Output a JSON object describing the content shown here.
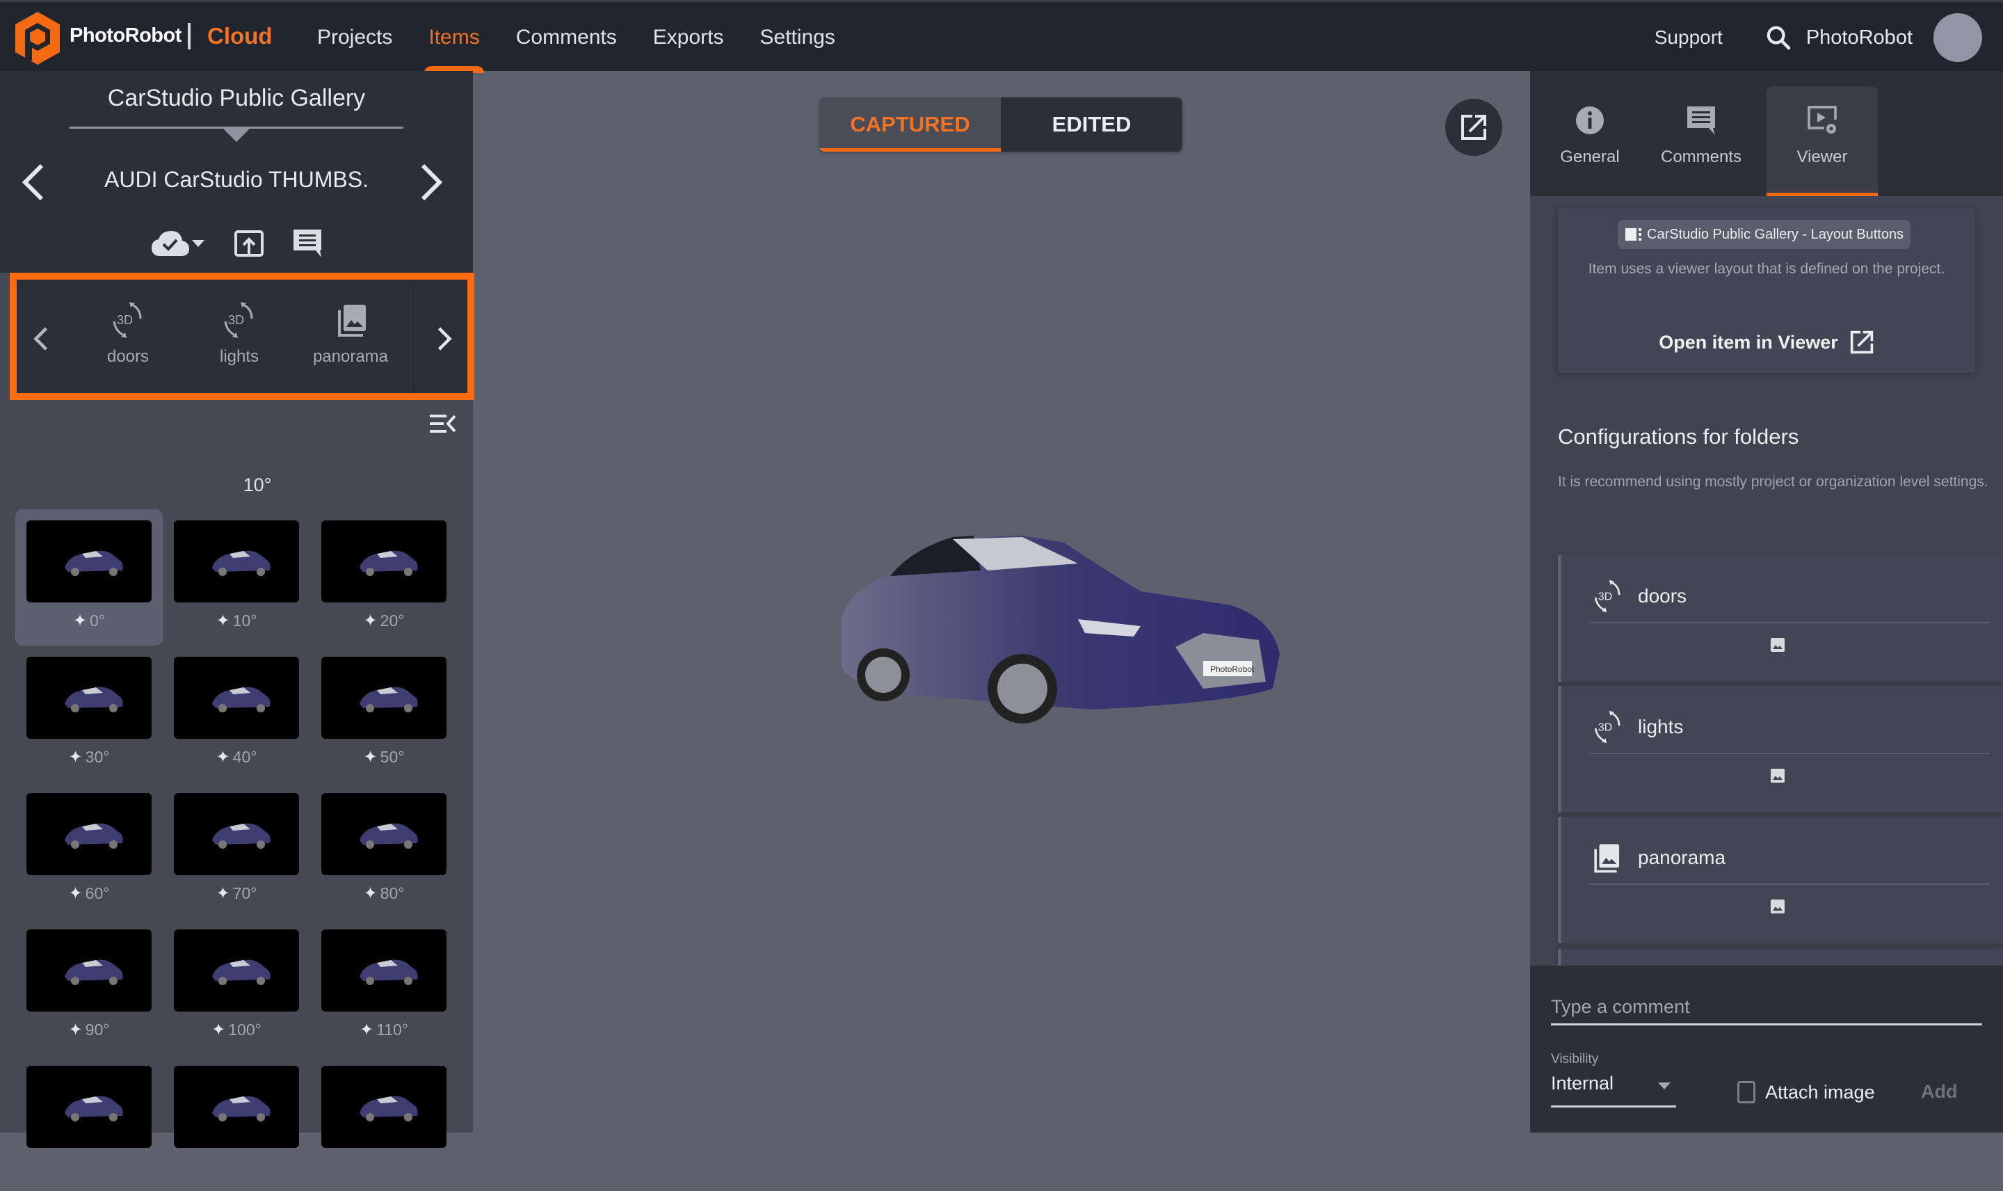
{
  "header": {
    "brand": "PhotoRobot",
    "product": "Cloud",
    "nav": [
      {
        "label": "Projects",
        "active": false
      },
      {
        "label": "Items",
        "active": true
      },
      {
        "label": "Comments",
        "active": false
      },
      {
        "label": "Exports",
        "active": false
      },
      {
        "label": "Settings",
        "active": false
      }
    ],
    "support_label": "Support",
    "user_name": "PhotoRobot",
    "accent_color": "#f47322"
  },
  "left_panel": {
    "gallery_title": "CarStudio Public Gallery",
    "item_title": "AUDI CarStudio THUMBS.",
    "tools": [
      "cloud-check-icon",
      "upload-icon",
      "comment-icon"
    ],
    "folders": [
      {
        "label": "doors",
        "icon": "3d-rotate-icon"
      },
      {
        "label": "lights",
        "icon": "3d-rotate-icon"
      },
      {
        "label": "panorama",
        "icon": "image-stack-icon"
      }
    ],
    "current_angle": "10°",
    "thumbnails": [
      {
        "label": "0°",
        "selected": true
      },
      {
        "label": "10°",
        "selected": false
      },
      {
        "label": "20°",
        "selected": false
      },
      {
        "label": "30°",
        "selected": false
      },
      {
        "label": "40°",
        "selected": false
      },
      {
        "label": "50°",
        "selected": false
      },
      {
        "label": "60°",
        "selected": false
      },
      {
        "label": "70°",
        "selected": false
      },
      {
        "label": "80°",
        "selected": false
      },
      {
        "label": "90°",
        "selected": false
      },
      {
        "label": "100°",
        "selected": false
      },
      {
        "label": "110°",
        "selected": false
      },
      {
        "label": "",
        "selected": false
      },
      {
        "label": "",
        "selected": false
      },
      {
        "label": "",
        "selected": false
      }
    ]
  },
  "center": {
    "tabs": [
      {
        "label": "CAPTURED",
        "active": true
      },
      {
        "label": "EDITED",
        "active": false
      }
    ],
    "plate_text": "PhotoRobot"
  },
  "right_panel": {
    "tabs": [
      {
        "label": "General",
        "icon": "info-icon",
        "active": false
      },
      {
        "label": "Comments",
        "icon": "comment-icon",
        "active": false
      },
      {
        "label": "Viewer",
        "icon": "viewer-settings-icon",
        "active": true
      }
    ],
    "layout_chip": "CarStudio Public Gallery - Layout Buttons",
    "layout_desc": "Item uses a viewer layout that is defined on the project.",
    "open_viewer": "Open item in Viewer",
    "config_title": "Configurations for folders",
    "config_desc": "It is recommend using mostly project or organization level settings.",
    "config_folders": [
      {
        "label": "doors",
        "icon": "3d-rotate-icon"
      },
      {
        "label": "lights",
        "icon": "3d-rotate-icon"
      },
      {
        "label": "panorama",
        "icon": "image-stack-icon"
      }
    ]
  },
  "comment": {
    "placeholder": "Type a comment",
    "visibility_label": "Visibility",
    "visibility_value": "Internal",
    "attach_label": "Attach image",
    "add_label": "Add"
  }
}
